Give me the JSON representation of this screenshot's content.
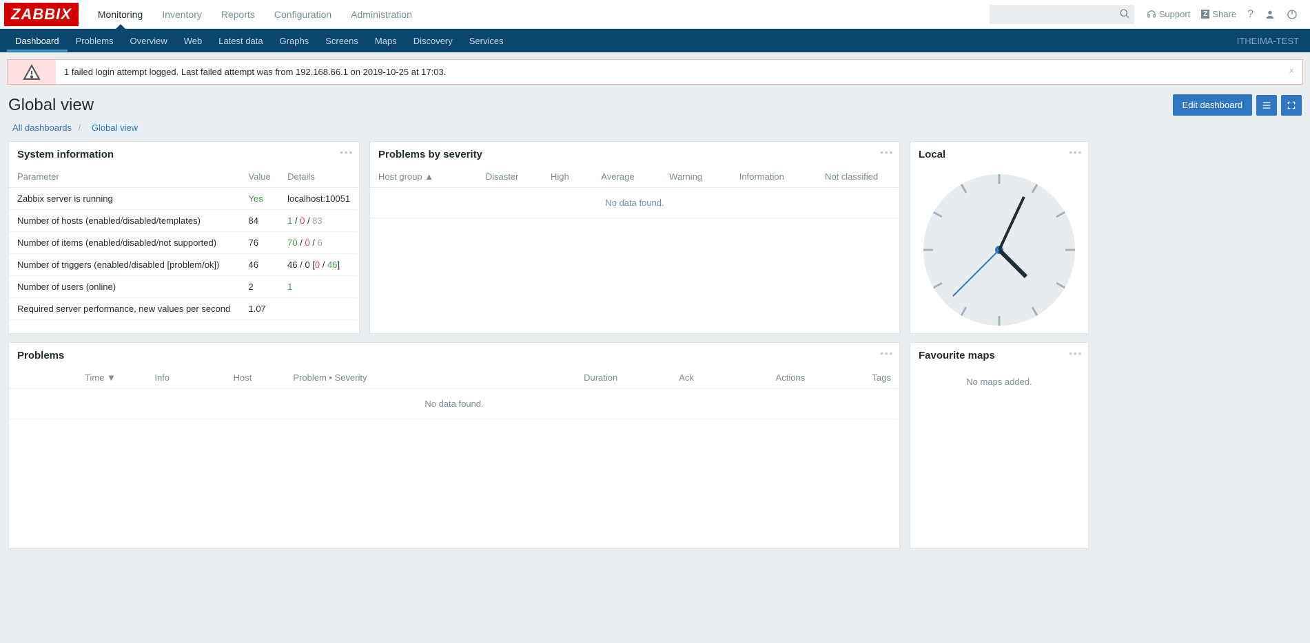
{
  "brand": "ZABBIX",
  "topnav": [
    "Monitoring",
    "Inventory",
    "Reports",
    "Configuration",
    "Administration"
  ],
  "topnav_active": 0,
  "top_right": {
    "support": "Support",
    "share": "Share"
  },
  "server_name": "ITHEIMA-TEST",
  "subnav": [
    "Dashboard",
    "Problems",
    "Overview",
    "Web",
    "Latest data",
    "Graphs",
    "Screens",
    "Maps",
    "Discovery",
    "Services"
  ],
  "subnav_active": 0,
  "alert": "1 failed login attempt logged. Last failed attempt was from 192.168.66.1 on 2019-10-25 at 17:03.",
  "page_title": "Global view",
  "edit_btn": "Edit dashboard",
  "breadcrumb": {
    "all": "All dashboards",
    "current": "Global view"
  },
  "widgets": {
    "sysinfo": {
      "title": "System information",
      "headers": [
        "Parameter",
        "Value",
        "Details"
      ],
      "rows": [
        {
          "param": "Zabbix server is running",
          "value": "Yes",
          "value_class": "green",
          "details": [
            {
              "t": "localhost:10051"
            }
          ]
        },
        {
          "param": "Number of hosts (enabled/disabled/templates)",
          "value": "84",
          "details": [
            {
              "t": "1",
              "c": "green"
            },
            {
              "t": " / "
            },
            {
              "t": "0",
              "c": "red"
            },
            {
              "t": " / "
            },
            {
              "t": "83",
              "c": "grey"
            }
          ]
        },
        {
          "param": "Number of items (enabled/disabled/not supported)",
          "value": "76",
          "details": [
            {
              "t": "70",
              "c": "green"
            },
            {
              "t": " / "
            },
            {
              "t": "0",
              "c": "red"
            },
            {
              "t": " / "
            },
            {
              "t": "6",
              "c": "grey"
            }
          ]
        },
        {
          "param": "Number of triggers (enabled/disabled [problem/ok])",
          "value": "46",
          "details": [
            {
              "t": "46"
            },
            {
              "t": " / "
            },
            {
              "t": "0"
            },
            {
              "t": " ["
            },
            {
              "t": "0",
              "c": "red"
            },
            {
              "t": " / "
            },
            {
              "t": "46",
              "c": "green"
            },
            {
              "t": "]"
            }
          ]
        },
        {
          "param": "Number of users (online)",
          "value": "2",
          "details": [
            {
              "t": "1",
              "c": "green"
            }
          ]
        },
        {
          "param": "Required server performance, new values per second",
          "value": "1.07",
          "details": []
        }
      ]
    },
    "severity": {
      "title": "Problems by severity",
      "headers": [
        "Host group ▲",
        "Disaster",
        "High",
        "Average",
        "Warning",
        "Information",
        "Not classified"
      ],
      "empty": "No data found."
    },
    "clock": {
      "title": "Local",
      "hour_angle": 135,
      "min_angle": 25,
      "sec_angle": 225
    },
    "problems": {
      "title": "Problems",
      "headers": [
        "Time ▼",
        "Info",
        "Host",
        "Problem • Severity",
        "Duration",
        "Ack",
        "Actions",
        "Tags"
      ],
      "empty": "No data found."
    },
    "favmaps": {
      "title": "Favourite maps",
      "empty": "No maps added."
    }
  }
}
